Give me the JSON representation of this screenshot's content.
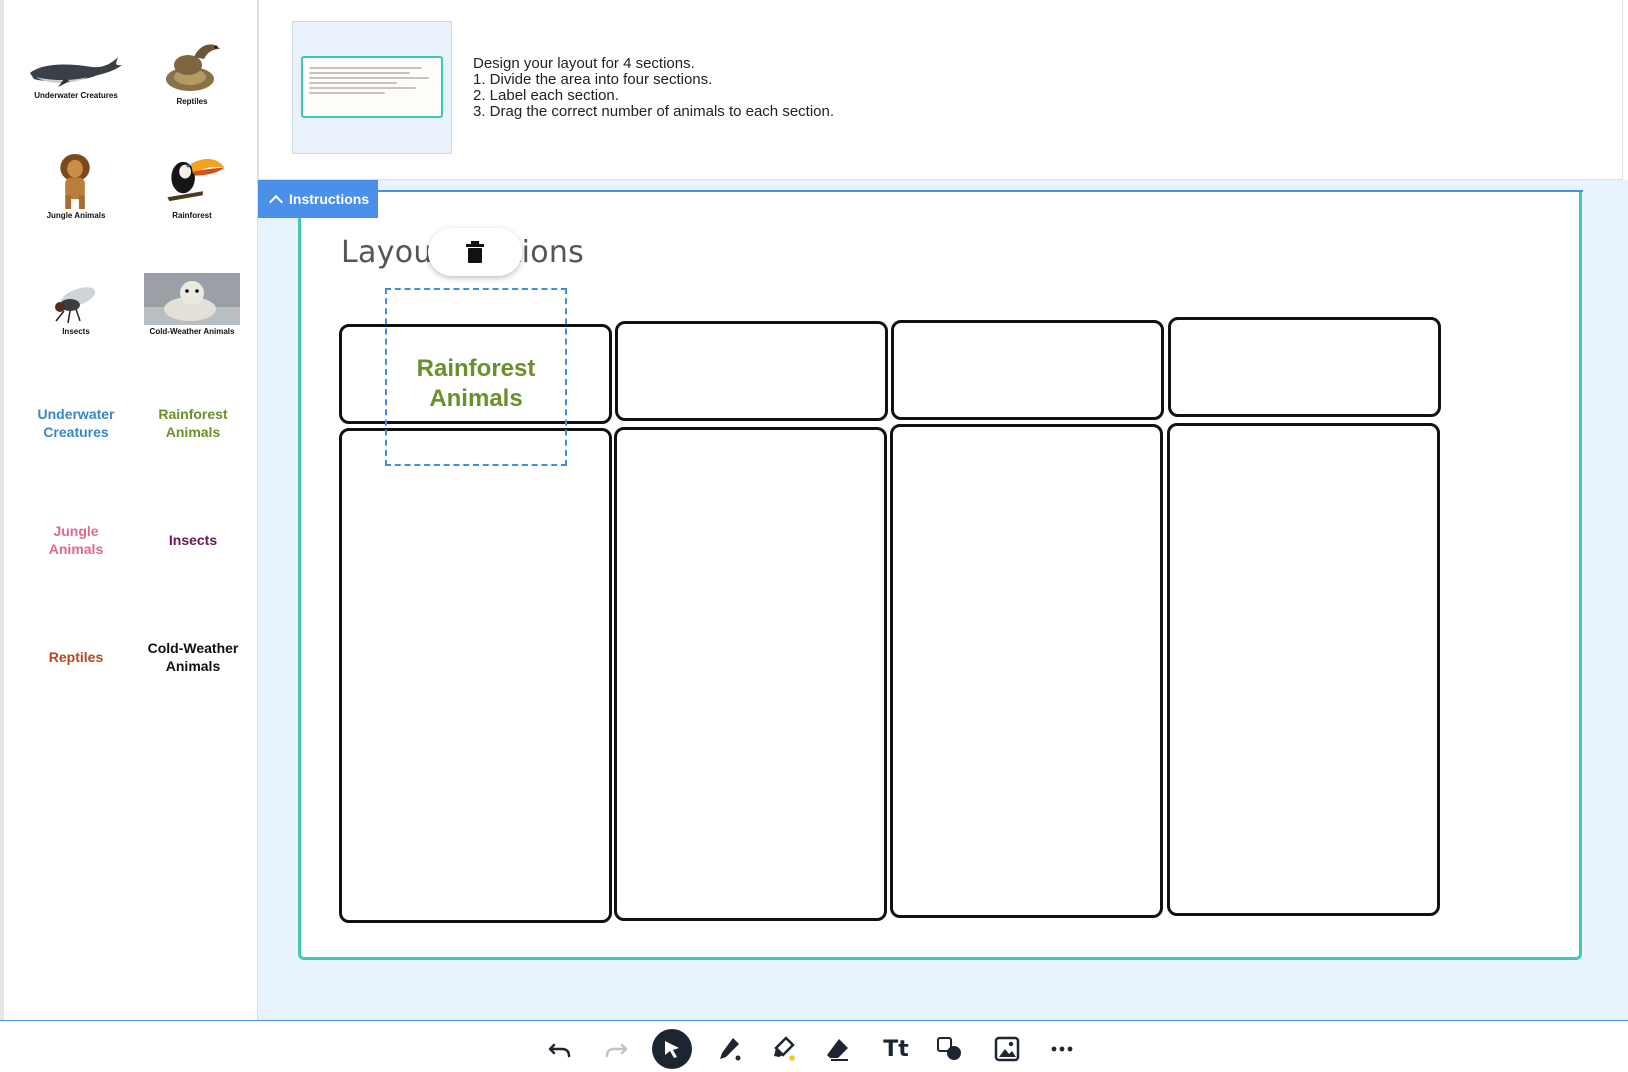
{
  "sidebar": {
    "image_tiles": [
      {
        "label": "Underwater Creatures",
        "icon": "whale-icon"
      },
      {
        "label": "Reptiles",
        "icon": "snake-icon"
      },
      {
        "label": "Jungle Animals",
        "icon": "lion-icon"
      },
      {
        "label": "Rainforest",
        "icon": "toucan-icon"
      },
      {
        "label": "Insects",
        "icon": "fly-icon"
      },
      {
        "label": "Cold-Weather Animals",
        "icon": "seal-icon"
      }
    ],
    "word_tiles": [
      {
        "text": "Underwater Creatures",
        "color": "#3a86c8"
      },
      {
        "text": "Rainforest Animals",
        "color": "#6d8f2a"
      },
      {
        "text": "Jungle Animals",
        "color": "#e06a8a"
      },
      {
        "text": "Insects",
        "color": "#6a1850"
      },
      {
        "text": "Reptiles",
        "color": "#b5471e"
      },
      {
        "text": "Cold-Weather Animals",
        "color": "#111111"
      }
    ]
  },
  "instructions": {
    "lines": [
      "Design your layout for 4 sections.",
      "1. Divide the area into four sections.",
      "2. Label each section.",
      "3. Drag the correct number of animals to each section."
    ],
    "tab_label": "Instructions"
  },
  "slide": {
    "title": "Layout Sections",
    "placed_label": "Rainforest Animals",
    "placed_label_color": "#6d8f2a"
  },
  "colors": {
    "accent": "#4a8fe8",
    "canvas_border": "#43c7b4",
    "workspace_bg": "#e8f4fd"
  },
  "toolbar": {
    "text_tool_label": "Tt",
    "tools": [
      "undo-icon",
      "redo-icon",
      "select-icon",
      "pen-icon",
      "highlighter-icon",
      "eraser-icon",
      "text-tool",
      "shapes-icon",
      "image-icon",
      "more-icon"
    ]
  }
}
